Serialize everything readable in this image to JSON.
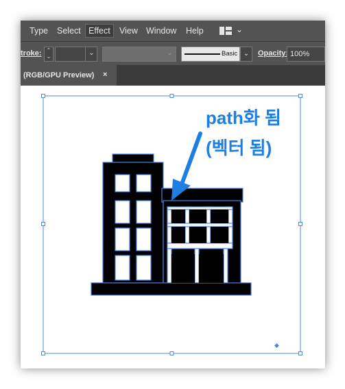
{
  "menubar": {
    "items": [
      "Type",
      "Select",
      "Effect",
      "View",
      "Window",
      "Help"
    ],
    "active": "Effect",
    "workspace_icon": "workspace-layout-icon",
    "workspace_chevron": "⌄"
  },
  "controlbar": {
    "stroke_label": "troke:",
    "stepper_up": "⌃",
    "stepper_down": "⌄",
    "dropdown_glyph": "⌄",
    "brush_label": "Basic",
    "opacity_label": "Opacity:",
    "opacity_value": "100%"
  },
  "document_tab": {
    "title": "(RGB/GPU Preview)",
    "close_glyph": "×"
  },
  "annotation": {
    "line1": "path화 됨",
    "line2": "(벡터 됨)",
    "color": "#1f7fe0"
  },
  "colors": {
    "ui_panel": "#535353",
    "selection": "#4a86e8",
    "artwork": "#000000"
  }
}
